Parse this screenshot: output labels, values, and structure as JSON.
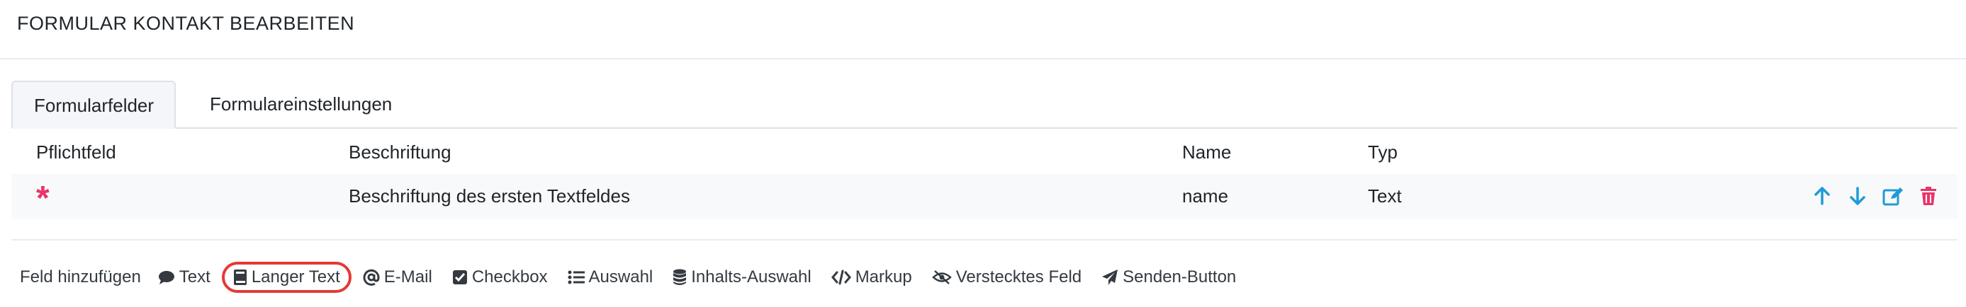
{
  "header": {
    "title": "FORMULAR KONTAKT BEARBEITEN"
  },
  "tabs": [
    {
      "label": "Formularfelder",
      "active": true
    },
    {
      "label": "Formulareinstellungen",
      "active": false
    }
  ],
  "table": {
    "columns": [
      "Pflichtfeld",
      "Beschriftung",
      "Name",
      "Typ"
    ],
    "rows": [
      {
        "required": "*",
        "label": "Beschriftung des ersten Textfeldes",
        "name": "name",
        "type": "Text",
        "actions": [
          "arrow-up-icon",
          "arrow-down-icon",
          "edit-icon",
          "trash-icon"
        ]
      }
    ]
  },
  "toolbar": {
    "label": "Feld hinzufügen",
    "items": [
      {
        "label": "Text",
        "icon": "comment-icon"
      },
      {
        "label": "Langer Text",
        "icon": "book-icon",
        "highlighted": true
      },
      {
        "label": "E-Mail",
        "icon": "at-icon"
      },
      {
        "label": "Checkbox",
        "icon": "checkbox-icon"
      },
      {
        "label": "Auswahl",
        "icon": "list-icon"
      },
      {
        "label": "Inhalts-Auswahl",
        "icon": "database-icon"
      },
      {
        "label": "Markup",
        "icon": "code-icon"
      },
      {
        "label": "Verstecktes Feld",
        "icon": "eye-slash-icon"
      },
      {
        "label": "Senden-Button",
        "icon": "paper-plane-icon"
      }
    ]
  },
  "colors": {
    "required": "#e8356b",
    "action_blue": "#1e9bd7",
    "delete_red": "#e8356b",
    "highlight": "#e53935"
  }
}
